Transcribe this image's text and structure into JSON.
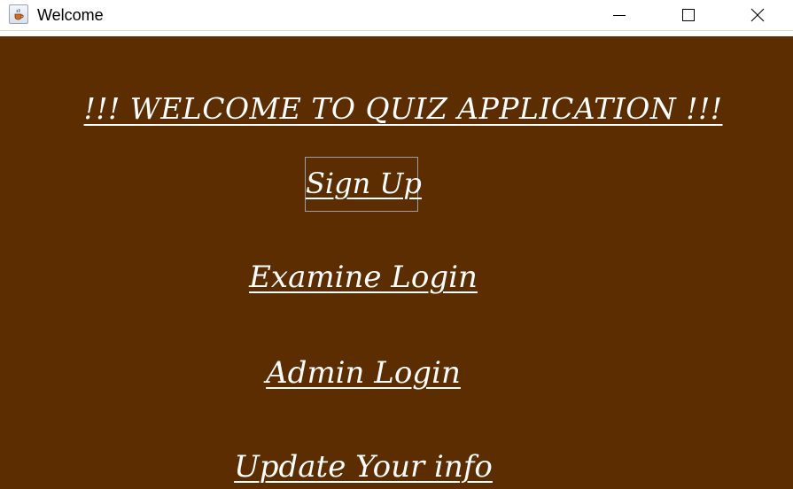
{
  "window": {
    "title": "Welcome",
    "controls": {
      "minimize": "minimize",
      "maximize": "maximize",
      "close": "close"
    },
    "icon": "java-cup-icon"
  },
  "main": {
    "heading": "!!! WELCOME TO QUIZ APPLICATION !!!",
    "buttons": {
      "signup": "Sign Up",
      "examine_login": "Examine Login",
      "admin_login": "Admin Login",
      "update_info": "Update Your info"
    }
  },
  "colors": {
    "background": "#5c2d00",
    "text": "#ffffff",
    "titlebar": "#ffffff"
  }
}
